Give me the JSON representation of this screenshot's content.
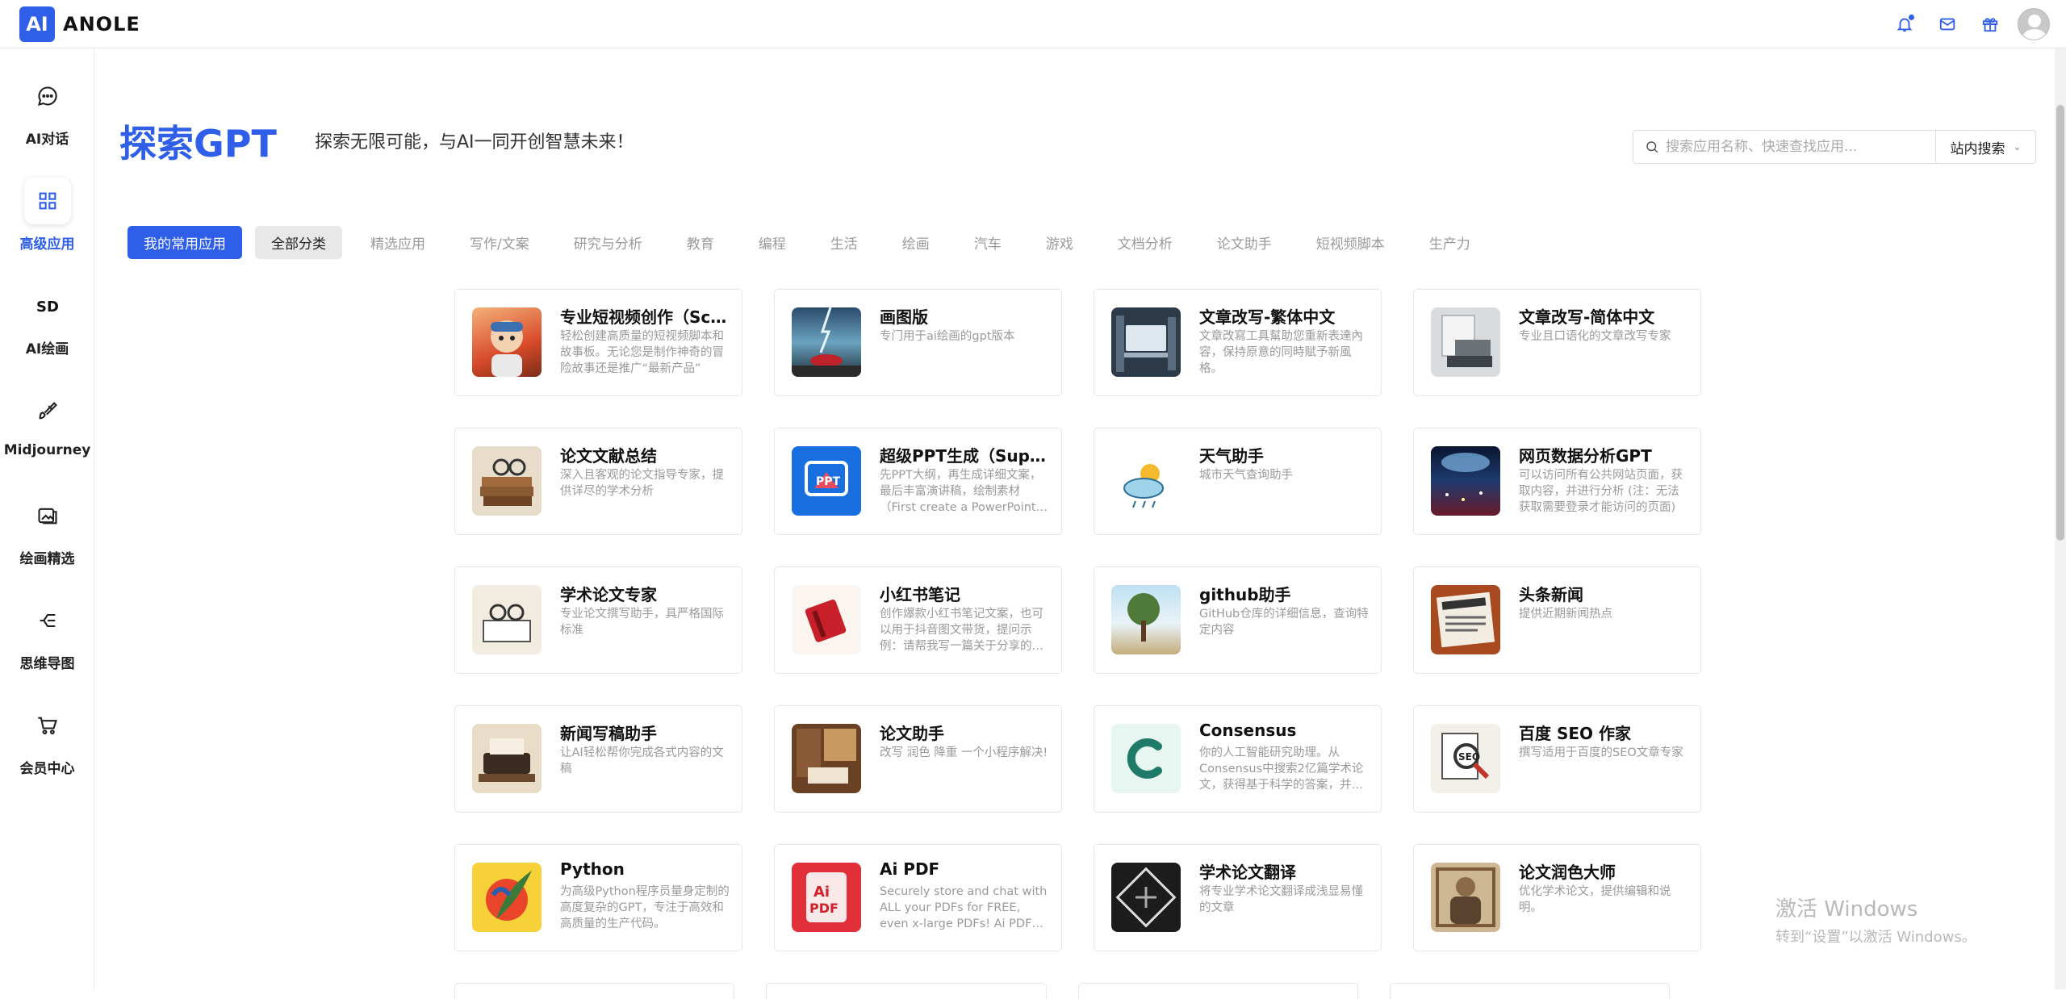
{
  "app": {
    "logo_mark": "AI",
    "name": "ANOLE"
  },
  "colors": {
    "accent": "#2f5fe8",
    "tab_secondary_bg": "#e8e8e8"
  },
  "header_icons": [
    "bell-icon",
    "mail-icon",
    "gift-icon",
    "avatar"
  ],
  "sidebar": {
    "items": [
      {
        "label": "AI对话",
        "icon": "chat-bubble-icon",
        "active": false
      },
      {
        "label": "高级应用",
        "icon": "grid-icon",
        "active": true
      },
      {
        "label": "AI绘画",
        "icon": "sd-logo-icon",
        "active": false
      },
      {
        "label": "Midjourney",
        "icon": "brush-icon",
        "active": false
      },
      {
        "label": "绘画精选",
        "icon": "image-icon",
        "active": false
      },
      {
        "label": "思维导图",
        "icon": "mindmap-icon",
        "active": false
      },
      {
        "label": "会员中心",
        "icon": "cart-icon",
        "active": false
      }
    ]
  },
  "hero": {
    "title": "探索GPT",
    "subtitle": "探索无限可能，与AI一同开创智慧未来！"
  },
  "search": {
    "placeholder": "搜索应用名称、快速查找应用...",
    "scope": "站内搜索"
  },
  "tabs": [
    "我的常用应用",
    "全部分类",
    "精选应用",
    "写作/文案",
    "研究与分析",
    "教育",
    "编程",
    "生活",
    "绘画",
    "汽车",
    "游戏",
    "文档分析",
    "论文助手",
    "短视频脚本",
    "生产力"
  ],
  "cards": [
    {
      "title": "专业短视频创作（Script Writer）",
      "desc": "轻松创建高质量的短视频脚本和故事板。无论您是制作神奇的冒险故事还是推广“最新产品”",
      "thumb": "cartoon-astronaut"
    },
    {
      "title": "画图版",
      "desc": "专门用于ai绘画的gpt版本",
      "thumb": "car-lightning"
    },
    {
      "title": "文章改写-繁体中文",
      "desc": "文章改寫工具幫助您重新表達內容，保持原意的同時賦予新風格。",
      "thumb": "laptop-tools"
    },
    {
      "title": "文章改写-简体中文",
      "desc": "专业且口语化的文章改写专家",
      "thumb": "typewriter-papers"
    },
    {
      "title": "论文文献总结",
      "desc": "深入且客观的论文指导专家，提供详尽的学术分析",
      "thumb": "books-glasses"
    },
    {
      "title": "超级PPT生成（Super PPT）",
      "desc": "先PPT大纲，再生成详细文案，最后丰富演讲稿，绘制素材（First create a PowerPoint outline）",
      "thumb": "ppt-logo"
    },
    {
      "title": "天气助手",
      "desc": "城市天气查询助手",
      "thumb": "weather-cloud"
    },
    {
      "title": "网页数据分析GPT",
      "desc": "可以访问所有公共网站页面，获取内容，并进行分析 (注：无法获取需要登录才能访问的页面)",
      "thumb": "earth-city"
    },
    {
      "title": "学术论文专家",
      "desc": "专业论文撰写助手，具严格国际标准",
      "thumb": "glasses-book"
    },
    {
      "title": "小红书笔记",
      "desc": "创作爆款小红书笔记文案，也可以用于抖音图文带货，提问示例：请帮我写一篇关于分享的笔记",
      "thumb": "red-notebook"
    },
    {
      "title": "github助手",
      "desc": "GitHub仓库的详细信息，查询特定内容",
      "thumb": "tree-landscape"
    },
    {
      "title": "头条新闻",
      "desc": "提供近期新闻热点",
      "thumb": "newspaper"
    },
    {
      "title": "新闻写稿助手",
      "desc": "让AI轻松帮你完成各式内容的文稿",
      "thumb": "typewriter-desk"
    },
    {
      "title": "论文助手",
      "desc": "改写 润色 降重 一个小程序解决!",
      "thumb": "library-desk"
    },
    {
      "title": "Consensus",
      "desc": "你的人工智能研究助理。从Consensus中搜索2亿篇学术论文，获得基于科学的答案，并起草内容",
      "thumb": "consensus-logo"
    },
    {
      "title": "百度 SEO 作家",
      "desc": "撰写适用于百度的SEO文章专家",
      "thumb": "seo-magnifier"
    },
    {
      "title": "Python",
      "desc": "为高级Python程序员量身定制的高度复杂的GPT，专注于高效和高质量的生产代码。",
      "thumb": "python-feather"
    },
    {
      "title": "Ai PDF",
      "desc": "Securely store and chat with ALL your PDFs for FREE, even x-large PDFs! Ai PDF powered",
      "thumb": "ai-pdf-logo"
    },
    {
      "title": "学术论文翻译",
      "desc": "将专业学术论文翻译成浅显易懂的文章",
      "thumb": "maze-cube"
    },
    {
      "title": "论文润色大师",
      "desc": "优化学术论文，提供编辑和说明。",
      "thumb": "scholar-portrait"
    }
  ],
  "watermark": {
    "line1": "激活 Windows",
    "line2": "转到“设置”以激活 Windows。"
  }
}
